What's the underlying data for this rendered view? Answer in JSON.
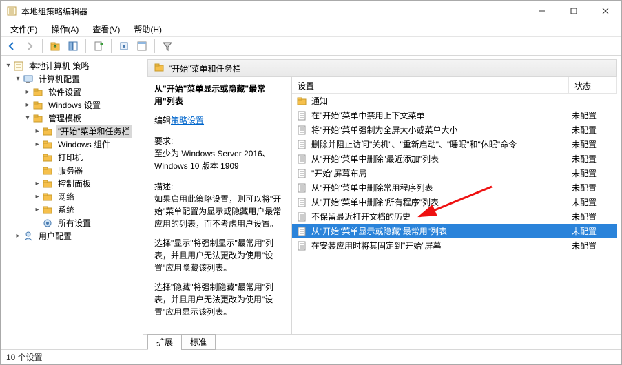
{
  "window": {
    "title": "本地组策略编辑器"
  },
  "menu": {
    "file": "文件(F)",
    "action": "操作(A)",
    "view": "查看(V)",
    "help": "帮助(H)"
  },
  "tree": {
    "root": "本地计算机 策略",
    "computer_config": "计算机配置",
    "software": "软件设置",
    "windows_settings": "Windows 设置",
    "admin_templates": "管理模板",
    "start_taskbar": "\"开始\"菜单和任务栏",
    "windows_components": "Windows 组件",
    "printers": "打印机",
    "server": "服务器",
    "control_panel": "控制面板",
    "network": "网络",
    "system": "系统",
    "all_settings": "所有设置",
    "user_config": "用户配置"
  },
  "right": {
    "header": "\"开始\"菜单和任务栏",
    "setting_name": "从\"开始\"菜单显示或隐藏\"最常用\"列表",
    "edit_prefix": "编辑",
    "edit_link": "策略设置",
    "req_label": "要求:",
    "req_text": "至少为 Windows Server 2016、Windows 10 版本 1909",
    "desc_label": "描述:",
    "desc_p1": "如果启用此策略设置，则可以将\"开始\"菜单配置为显示或隐藏用户最常应用的列表，而不考虑用户设置。",
    "desc_p2": "选择\"显示\"将强制显示\"最常用\"列表，并且用户无法更改为使用\"设置\"应用隐藏该列表。",
    "desc_p3": "选择\"隐藏\"将强制隐藏\"最常用\"列表，并且用户无法更改为使用\"设置\"应用显示该列表。"
  },
  "columns": {
    "setting": "设置",
    "status": "状态"
  },
  "status_unconfigured": "未配置",
  "items": {
    "folder_notifications": "通知",
    "i0": "在\"开始\"菜单中禁用上下文菜单",
    "i1": "将\"开始\"菜单强制为全屏大小或菜单大小",
    "i2": "删除并阻止访问\"关机\"、\"重新启动\"、\"睡眠\"和\"休眠\"命令",
    "i3": "从\"开始\"菜单中删除\"最近添加\"列表",
    "i4": "\"开始\"屏幕布局",
    "i5": "从\"开始\"菜单中删除常用程序列表",
    "i6": "从\"开始\"菜单中删除\"所有程序\"列表",
    "i7": "不保留最近打开文档的历史",
    "i8": "从\"开始\"菜单显示或隐藏\"最常用\"列表",
    "i9": "在安装应用时将其固定到\"开始\"屏幕"
  },
  "tabs": {
    "extended": "扩展",
    "standard": "标准"
  },
  "status_bar": "10 个设置"
}
